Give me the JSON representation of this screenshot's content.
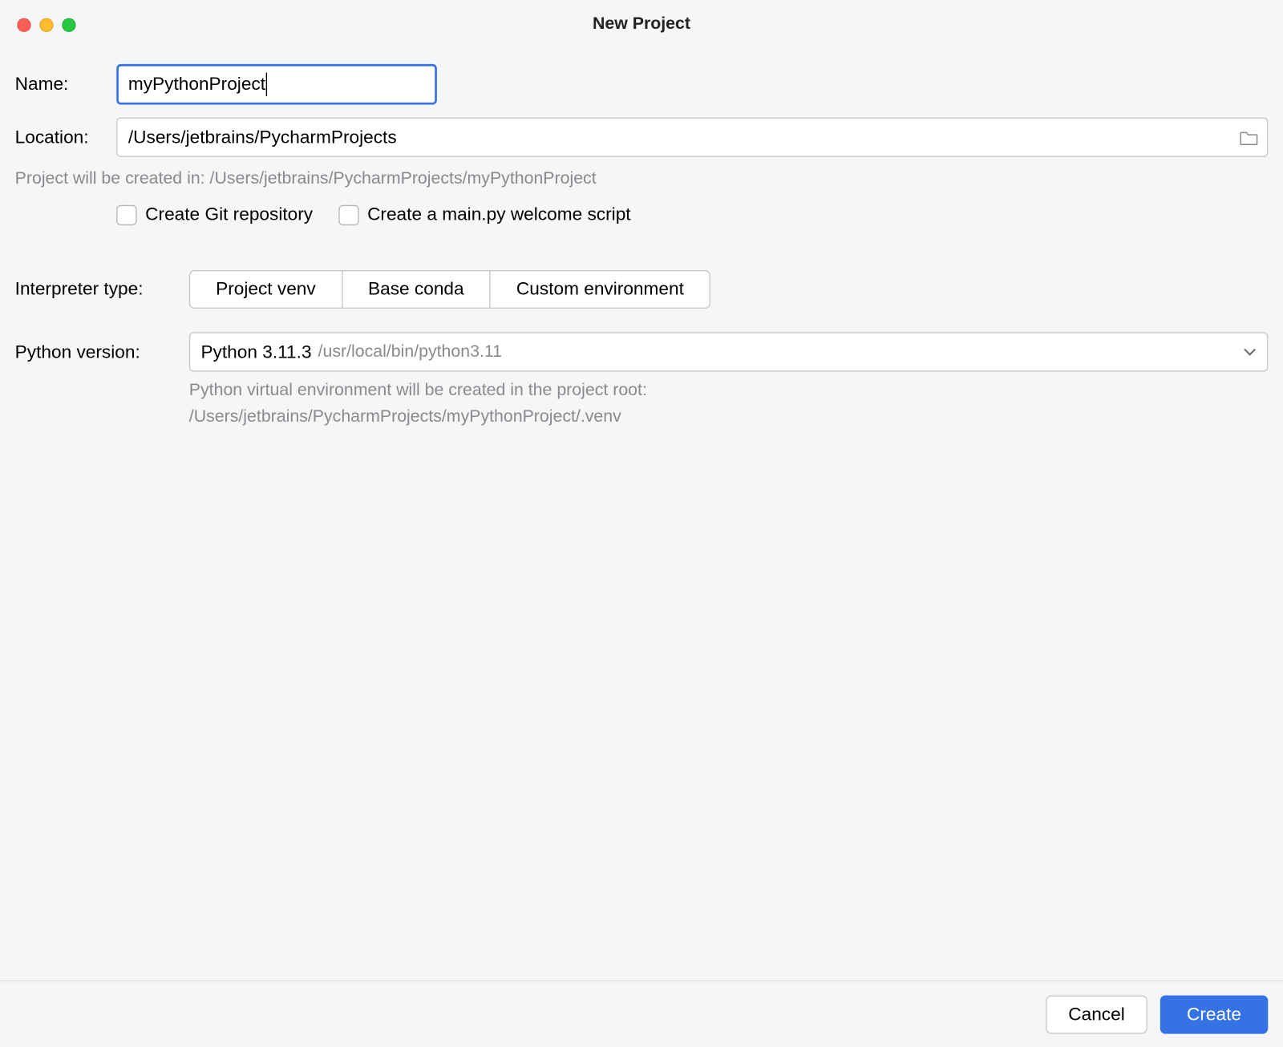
{
  "window": {
    "title": "New Project"
  },
  "name": {
    "label": "Name:",
    "value": "myPythonProject"
  },
  "location": {
    "label": "Location:",
    "value": "/Users/jetbrains/PycharmProjects",
    "hint": "Project will be created in: /Users/jetbrains/PycharmProjects/myPythonProject"
  },
  "checks": {
    "git": "Create Git repository",
    "mainpy": "Create a main.py welcome script"
  },
  "interpreter": {
    "label": "Interpreter type:",
    "options": [
      "Project venv",
      "Base conda",
      "Custom environment"
    ],
    "selected": "Project venv"
  },
  "python": {
    "label": "Python version:",
    "value": "Python 3.11.3",
    "path": "/usr/local/bin/python3.11",
    "hint_line1": "Python virtual environment will be created in the project root:",
    "hint_line2": "/Users/jetbrains/PycharmProjects/myPythonProject/.venv"
  },
  "footer": {
    "cancel": "Cancel",
    "create": "Create"
  }
}
